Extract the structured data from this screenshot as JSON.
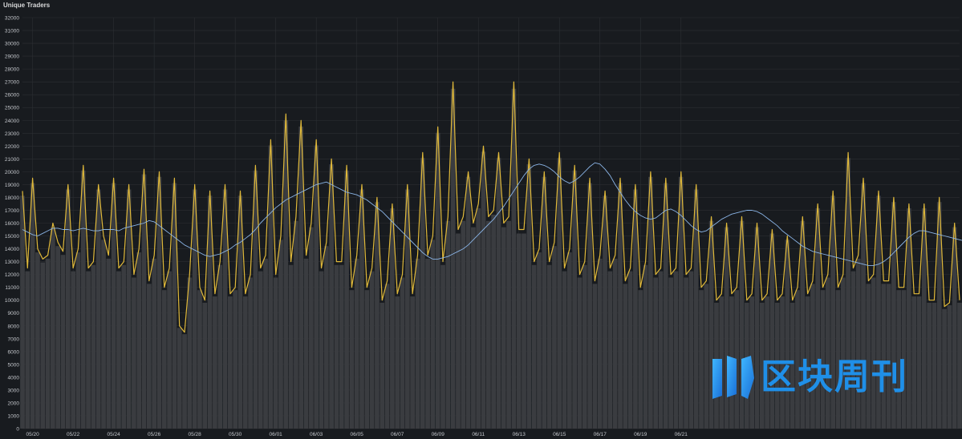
{
  "panel": {
    "title": "Unique Traders"
  },
  "watermark": {
    "text": "区块周刊"
  },
  "colors": {
    "background": "#181b1f",
    "grid": "#2c2f33",
    "bars": "#3a3c40",
    "series_main": "#e0b93a",
    "series_avg": "#8ab4e6",
    "axis_text": "#c4c7cc",
    "watermark": "#1f8fe8"
  },
  "chart_data": {
    "type": "line",
    "title": "Unique Traders",
    "xlabel": "",
    "ylabel": "",
    "ylim": [
      0,
      32000
    ],
    "yticks": [
      0,
      1000,
      2000,
      3000,
      4000,
      5000,
      6000,
      7000,
      8000,
      9000,
      10000,
      11000,
      12000,
      13000,
      14000,
      15000,
      16000,
      17000,
      18000,
      19000,
      20000,
      21000,
      22000,
      23000,
      24000,
      25000,
      26000,
      27000,
      28000,
      29000,
      30000,
      31000,
      32000
    ],
    "xticks": [
      "05/20",
      "05/22",
      "05/24",
      "05/26",
      "05/28",
      "05/30",
      "06/01",
      "06/03",
      "06/05",
      "06/07",
      "06/09",
      "06/11",
      "06/13",
      "06/15",
      "06/17",
      "06/19",
      "06/21"
    ],
    "x_start": "05/19 12:00",
    "x_end": "06/22 06:00",
    "step_hours": 6,
    "grid": true,
    "series": [
      {
        "values": [
          18500,
          12500,
          19500,
          14000,
          13200,
          13500,
          16000,
          14500,
          13800,
          19000,
          12500,
          14000,
          20500,
          12500,
          13000,
          19000,
          15000,
          13500,
          19500,
          12500,
          13000,
          19000,
          12000,
          14000,
          20200,
          11500,
          13500,
          20000,
          11000,
          12500,
          19500,
          8000,
          7500,
          12000,
          19000,
          11000,
          10000,
          18500,
          10500,
          13000,
          19000,
          10500,
          11000,
          18500,
          10500,
          12000,
          20500,
          12500,
          13500,
          22500,
          12000,
          15000,
          24500,
          13000,
          16500,
          24000,
          13500,
          16000,
          22500,
          12500,
          14500,
          21000,
          13000,
          13000,
          20500,
          11000,
          13500,
          19000,
          11000,
          12500,
          18000,
          10000,
          11500,
          17500,
          10500,
          12000,
          19000,
          10500,
          13500,
          21500,
          13500,
          15000,
          23500,
          13000,
          16500,
          27000,
          15500,
          16500,
          20000,
          16000,
          17500,
          22000,
          16500,
          17000,
          21500,
          16000,
          16500,
          27000,
          15500,
          15500,
          21000,
          13000,
          14000,
          20000,
          13000,
          14500,
          21500,
          12500,
          14000,
          20500,
          12000,
          13000,
          19500,
          11500,
          13500,
          18500,
          12500,
          13500,
          19500,
          11500,
          12500,
          19000,
          11000,
          13000,
          20000,
          12000,
          12500,
          19500,
          12000,
          12500,
          20000,
          12000,
          12500,
          19000,
          11000,
          11500,
          16500,
          10000,
          10500,
          16000,
          10500,
          11000,
          16500,
          10000,
          10500,
          16000,
          10000,
          10500,
          15500,
          10000,
          10500,
          15000,
          10000,
          11000,
          16500,
          10500,
          11500,
          17500,
          11000,
          12000,
          18500,
          11000,
          12000,
          21500,
          12500,
          13500,
          19500,
          11500,
          12000,
          18500,
          11500,
          11500,
          18000,
          11000,
          11000,
          17500,
          10500,
          10500,
          17500,
          10000,
          10000,
          18000,
          9500,
          9800,
          16000,
          10000
        ],
        "color": "#e0b93a"
      },
      {
        "values": [
          15500,
          15300,
          15100,
          15000,
          15200,
          15400,
          15600,
          15600,
          15500,
          15500,
          15400,
          15500,
          15600,
          15500,
          15400,
          15400,
          15500,
          15500,
          15500,
          15400,
          15600,
          15700,
          15800,
          15900,
          16000,
          16200,
          16100,
          15800,
          15500,
          15200,
          14900,
          14600,
          14300,
          14100,
          13900,
          13700,
          13500,
          13400,
          13500,
          13600,
          13800,
          14000,
          14300,
          14500,
          14800,
          15100,
          15500,
          16000,
          16400,
          16800,
          17200,
          17500,
          17800,
          18000,
          18200,
          18400,
          18600,
          18800,
          19000,
          19100,
          19200,
          19000,
          18800,
          18600,
          18400,
          18300,
          18200,
          18000,
          17800,
          17500,
          17200,
          16900,
          16500,
          16100,
          15700,
          15300,
          14900,
          14500,
          14100,
          13700,
          13400,
          13200,
          13200,
          13300,
          13400,
          13600,
          13800,
          14000,
          14300,
          14700,
          15100,
          15500,
          15900,
          16300,
          16800,
          17300,
          17900,
          18500,
          19100,
          19700,
          20200,
          20500,
          20600,
          20500,
          20300,
          20000,
          19600,
          19300,
          19100,
          19300,
          19600,
          20000,
          20400,
          20700,
          20600,
          20200,
          19700,
          19000,
          18400,
          17800,
          17300,
          16900,
          16600,
          16400,
          16300,
          16400,
          16700,
          17000,
          17100,
          16900,
          16600,
          16200,
          15800,
          15500,
          15300,
          15400,
          15700,
          16000,
          16300,
          16500,
          16700,
          16800,
          16900,
          17000,
          17000,
          16900,
          16700,
          16400,
          16100,
          15800,
          15400,
          15100,
          14800,
          14500,
          14200,
          14000,
          13800,
          13700,
          13600,
          13500,
          13400,
          13300,
          13200,
          13100,
          13000,
          12900,
          12800,
          12700,
          12700,
          12800,
          13000,
          13300,
          13700,
          14100,
          14500,
          14900,
          15200,
          15400,
          15400,
          15300,
          15200,
          15100,
          15000,
          14900,
          14800,
          14700,
          14600,
          14500,
          14500,
          14400,
          14300,
          14200,
          14100,
          14100,
          14100,
          14000,
          13900,
          13700,
          13400,
          13100,
          12700,
          12200,
          11800
        ],
        "color": "#8ab4e6"
      }
    ],
    "annotations": []
  }
}
